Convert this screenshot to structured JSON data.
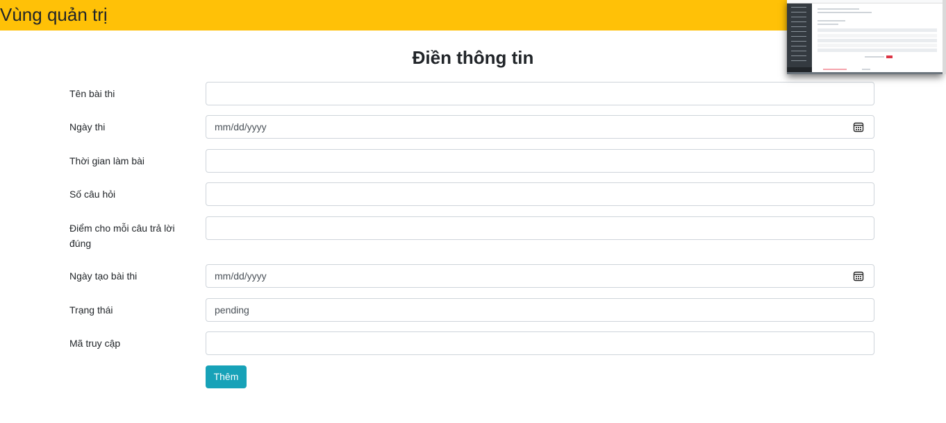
{
  "header": {
    "title": "Vùng quản trị",
    "bg_color": "#ffc107"
  },
  "form": {
    "title": "Điền thông tin",
    "fields": [
      {
        "label": "Tên bài thi",
        "value": "",
        "placeholder": ""
      },
      {
        "label": "Ngày thi",
        "value": "mm/dd/yyyy",
        "icon": "calendar-icon"
      },
      {
        "label": "Thời gian làm bài",
        "value": ""
      },
      {
        "label": "Số câu hỏi",
        "value": ""
      },
      {
        "label": "Điểm cho mỗi câu trả lời đúng",
        "value": ""
      },
      {
        "label": "Ngày tạo bài thi",
        "value": "mm/dd/yyyy",
        "icon": "calendar-icon"
      },
      {
        "label": "Trạng thái",
        "value": "pending"
      },
      {
        "label": "Mã truy cập",
        "value": ""
      }
    ],
    "submit_label": "Thêm",
    "submit_color": "#17a2b8"
  }
}
